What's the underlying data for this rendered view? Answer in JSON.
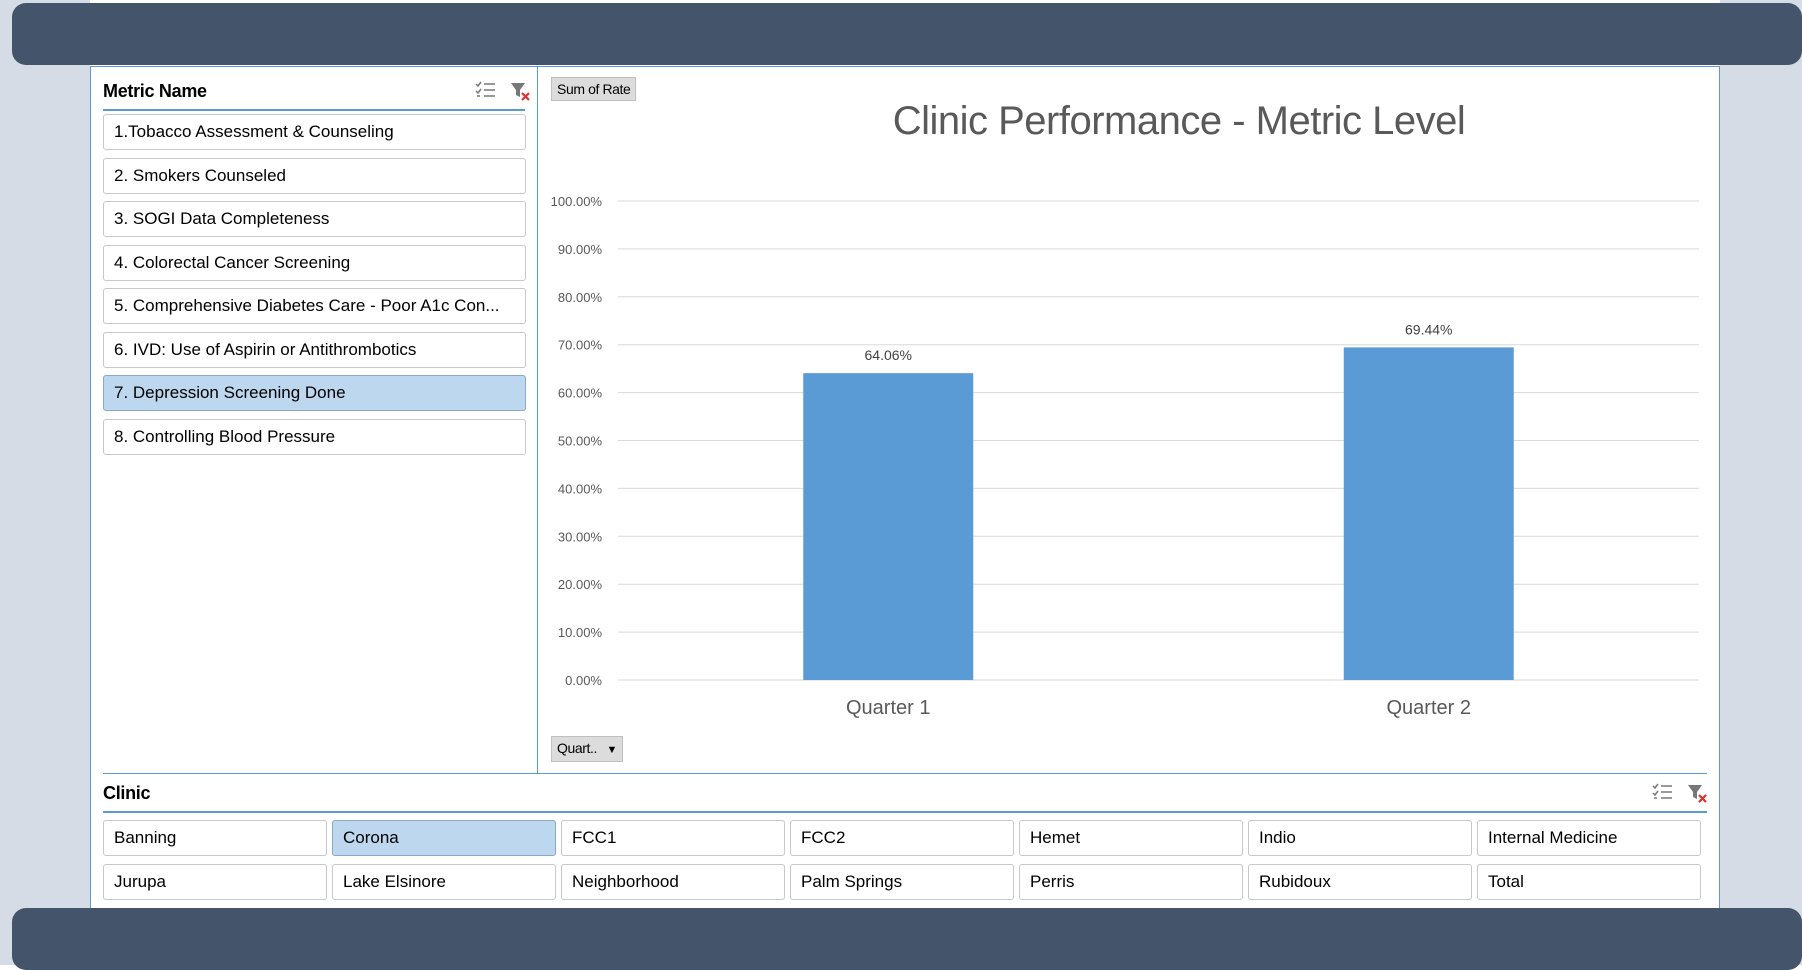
{
  "metric_slicer": {
    "title": "Metric Name",
    "selected_index": 6,
    "items": [
      "1.Tobacco Assessment & Counseling",
      "2. Smokers Counseled",
      "3. SOGI Data Completeness",
      "4. Colorectal Cancer Screening",
      "5. Comprehensive Diabetes Care - Poor A1c Con...",
      "6. IVD: Use of Aspirin or Antithrombotics",
      "7. Depression Screening Done",
      "8. Controlling Blood Pressure"
    ]
  },
  "chart": {
    "value_field_button": "Sum of Rate",
    "axis_field_button": "Quart..",
    "axis_field_icon": "dropdown-arrow-icon"
  },
  "chart_data": {
    "type": "bar",
    "title": "Clinic Performance - Metric Level",
    "categories": [
      "Quarter 1",
      "Quarter 2"
    ],
    "values": [
      64.06,
      69.44
    ],
    "data_labels": [
      "64.06%",
      "69.44%"
    ],
    "ylim": [
      0,
      100
    ],
    "yticks": [
      "0.00%",
      "10.00%",
      "20.00%",
      "30.00%",
      "40.00%",
      "50.00%",
      "60.00%",
      "70.00%",
      "80.00%",
      "90.00%",
      "100.00%"
    ],
    "grid": true,
    "bar_color": "#5b9bd5"
  },
  "clinic_slicer": {
    "title": "Clinic",
    "selected": "Corona",
    "rows": [
      [
        "Banning",
        "Corona",
        "FCC1",
        "FCC2",
        "Hemet",
        "Indio",
        "Internal Medicine"
      ],
      [
        "Jurupa",
        "Lake Elsinore",
        "Neighborhood",
        "Palm Springs",
        "Perris",
        "Rubidoux",
        "Total"
      ]
    ]
  },
  "colors": {
    "header_band": "#44546a",
    "side_background": "#d6dce5",
    "accent": "#5b9bd5",
    "selected_item": "#bdd7ee"
  }
}
